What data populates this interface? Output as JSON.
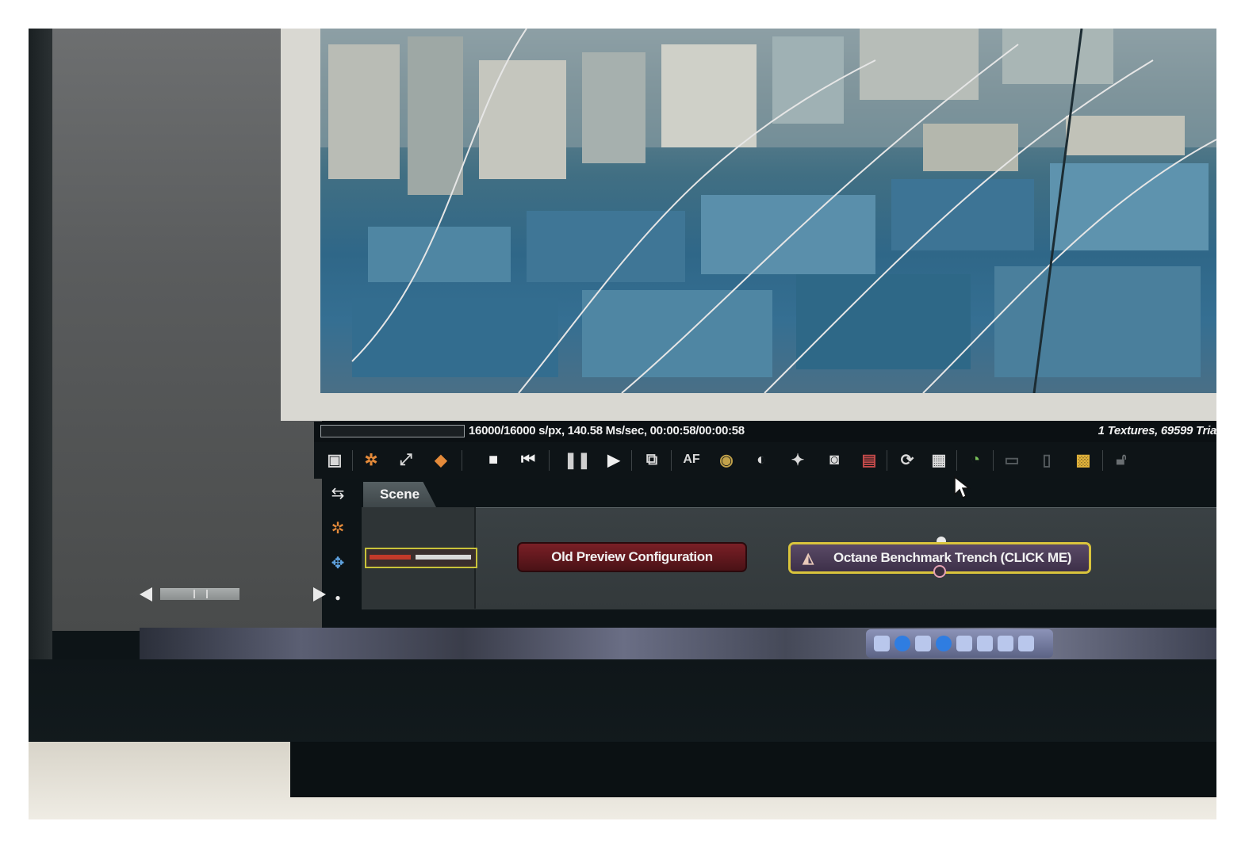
{
  "status": {
    "render_stats": "16000/16000 s/px, 140.58 Ms/sec, 00:00:58/00:00:58",
    "scene_stats": "1 Textures, 69599 Tria"
  },
  "toolbar": {
    "icons": [
      "image-icon",
      "target-icon",
      "expand-icon",
      "cube-icon",
      "stop-icon",
      "rewind-icon",
      "pause-icon",
      "play-icon",
      "region-icon",
      "af-icon",
      "color-icon",
      "sphere-icon",
      "light-icon",
      "camera-icon",
      "material-icon",
      "refresh-icon",
      "checker-icon",
      "gauge-icon",
      "copy-icon",
      "paste-icon",
      "checkerboard-icon",
      "lock-icon"
    ],
    "af_label": "AF"
  },
  "node_graph": {
    "tab_label": "Scene",
    "old_preview_node": "Old Preview Configuration",
    "octane_node": "Octane Benchmark Trench (CLICK ME)"
  },
  "colors": {
    "node_old": "#6a1a20",
    "node_octane_border": "#d9c43c",
    "viewport_blue": "#2f6788"
  }
}
